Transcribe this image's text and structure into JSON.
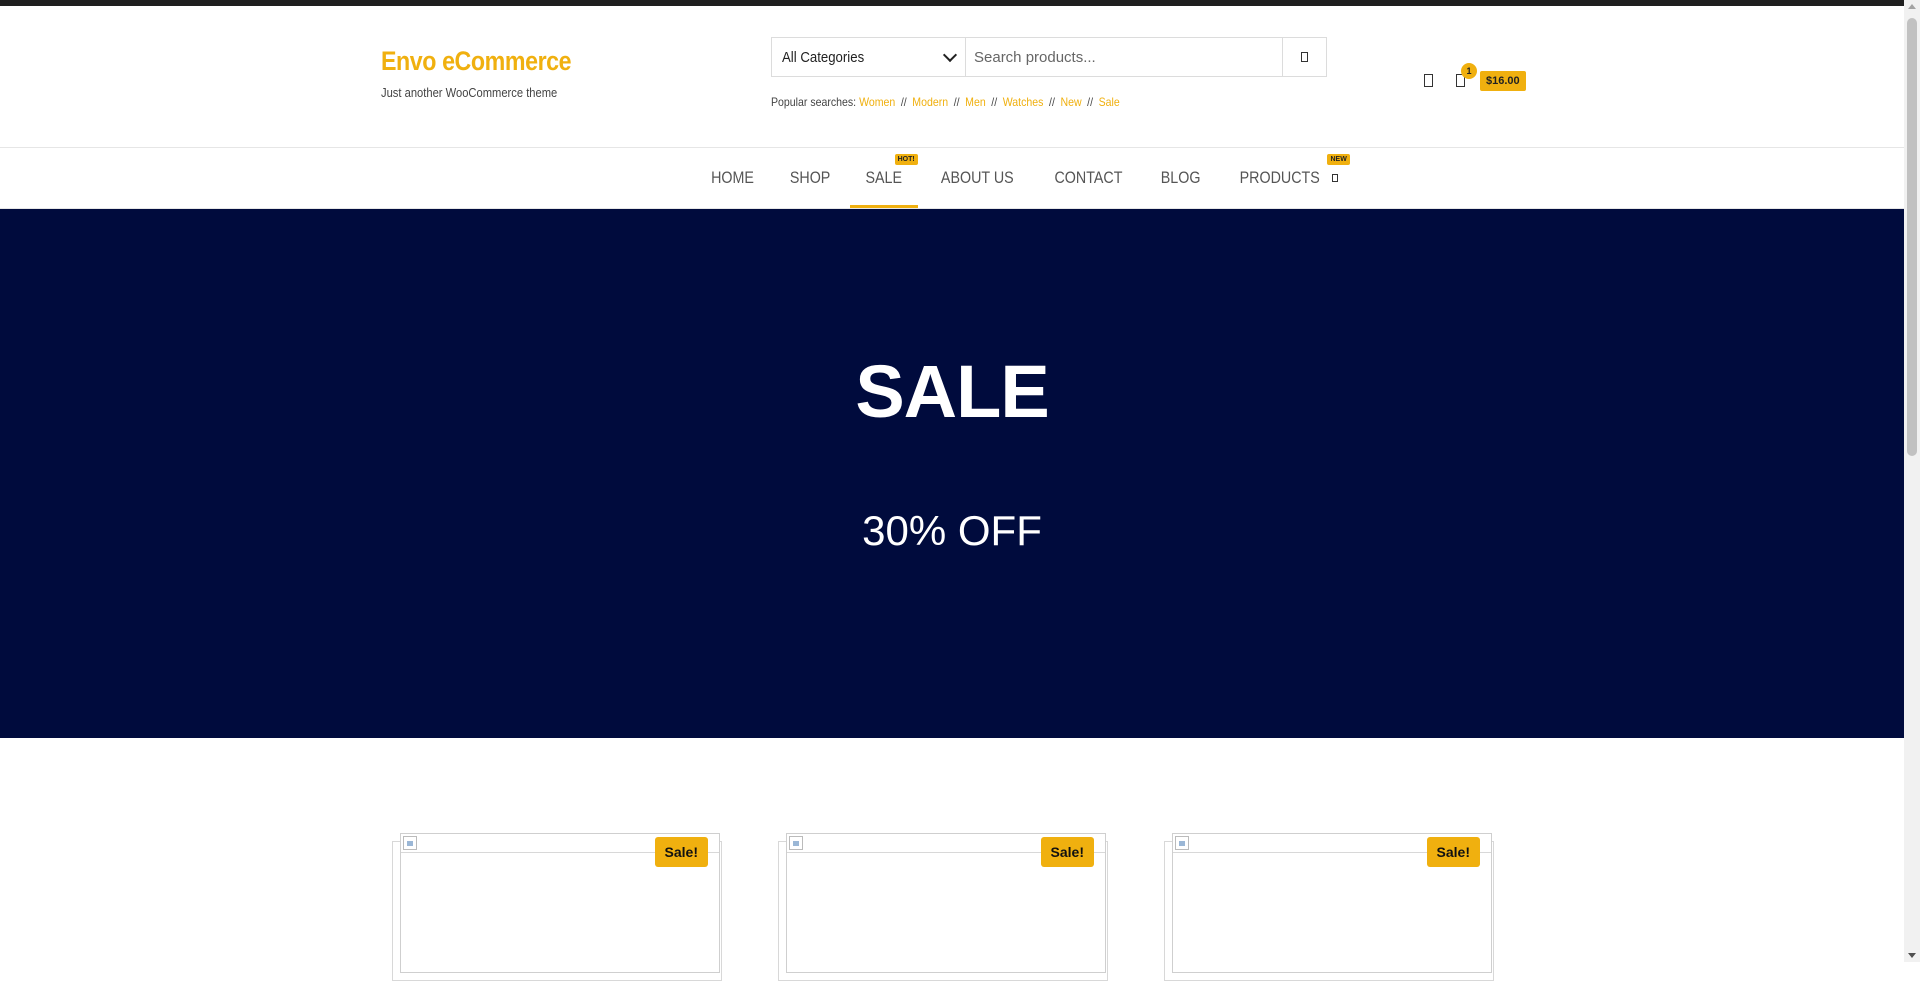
{
  "header": {
    "site_title": "Envo eCommerce",
    "tagline": "Just another WooCommerce theme",
    "search": {
      "category_selected": "All Categories",
      "placeholder": "Search products...",
      "button_icon": "search-icon"
    },
    "popular": {
      "label": "Popular searches:",
      "separator": "//",
      "terms": [
        "Women",
        "Modern",
        "Men",
        "Watches",
        "New",
        "Sale"
      ]
    },
    "account_icon": "user-icon",
    "cart": {
      "icon": "cart-icon",
      "count": "1",
      "total": "$16.00"
    }
  },
  "nav": {
    "items": [
      {
        "label": "HOME"
      },
      {
        "label": "SHOP"
      },
      {
        "label": "SALE",
        "badge": "HOT!",
        "active": true
      },
      {
        "label": "ABOUT US"
      },
      {
        "label": "CONTACT"
      },
      {
        "label": "BLOG"
      },
      {
        "label": "PRODUCTS",
        "badge": "NEW",
        "has_dropdown": true
      }
    ]
  },
  "hero": {
    "title": "SALE",
    "subtitle": "30% OFF"
  },
  "products": [
    {
      "badge": "Sale!"
    },
    {
      "badge": "Sale!"
    },
    {
      "badge": "Sale!"
    }
  ],
  "colors": {
    "accent": "#f0b00f",
    "hero_bg": "#000b3d",
    "topbar": "#1f1f1f"
  }
}
